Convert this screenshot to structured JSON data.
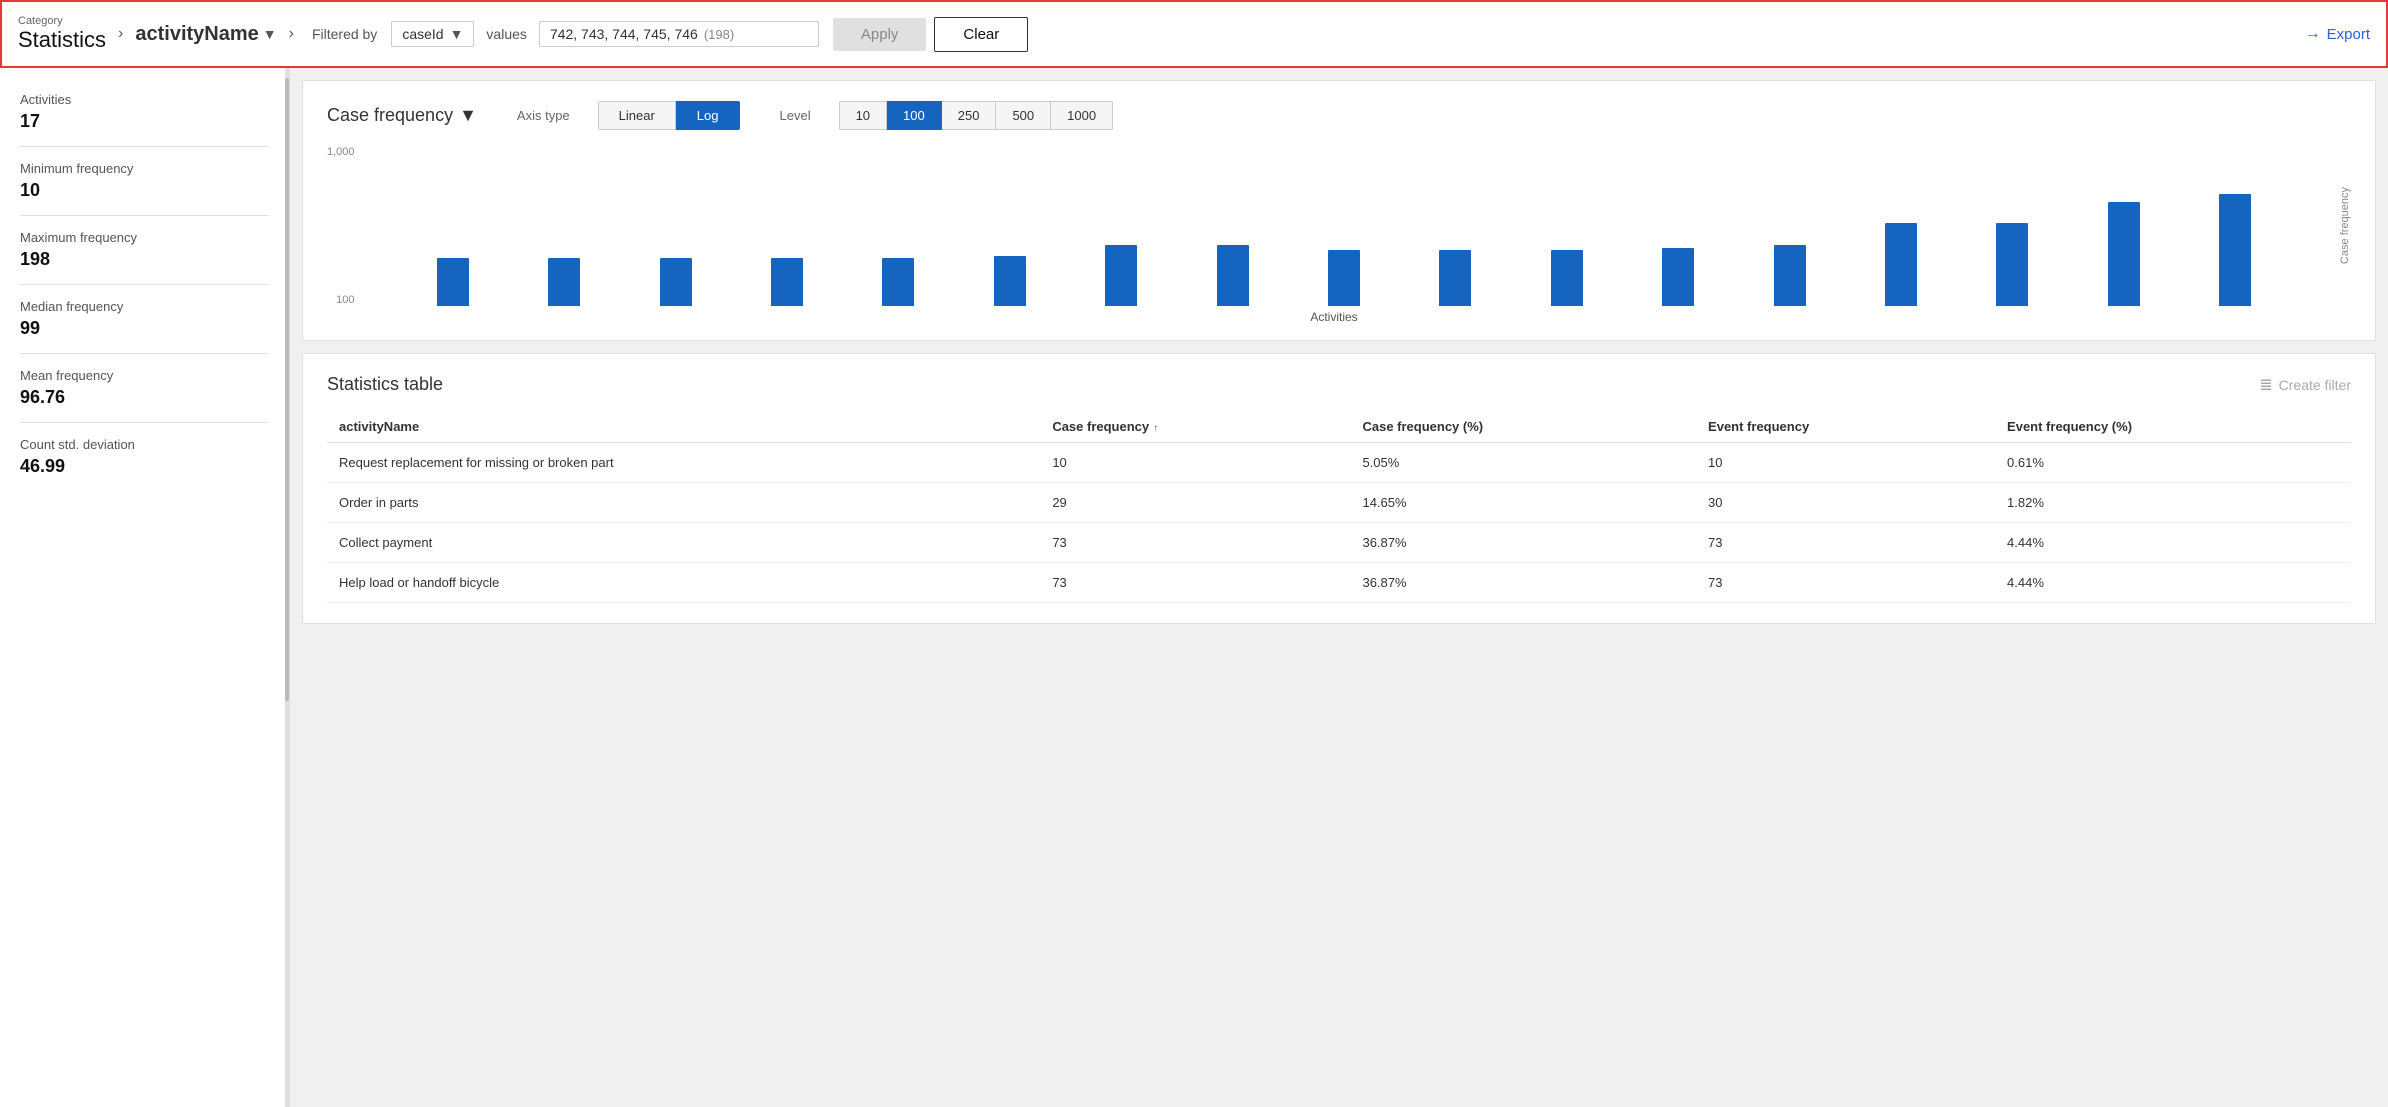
{
  "header": {
    "category_label": "Category",
    "category_value": "Statistics",
    "chevron": "›",
    "activity_name": "activityName",
    "chevron2": "›",
    "filtered_by": "Filtered by",
    "filter_field": "caseId",
    "values_label": "values",
    "values_text": "742, 743, 744, 745, 746",
    "values_count": "(198)",
    "apply_label": "Apply",
    "clear_label": "Clear",
    "export_label": "Export"
  },
  "sidebar": {
    "stats": [
      {
        "label": "Activities",
        "value": "17"
      },
      {
        "label": "Minimum frequency",
        "value": "10"
      },
      {
        "label": "Maximum frequency",
        "value": "198"
      },
      {
        "label": "Median frequency",
        "value": "99"
      },
      {
        "label": "Mean frequency",
        "value": "96.76"
      },
      {
        "label": "Count std. deviation",
        "value": "46.99"
      }
    ]
  },
  "chart": {
    "title": "Case frequency",
    "axis_type_label": "Axis type",
    "axis_options": [
      {
        "label": "Linear",
        "active": false
      },
      {
        "label": "Log",
        "active": true
      }
    ],
    "level_label": "Level",
    "level_options": [
      {
        "label": "10",
        "active": false
      },
      {
        "label": "100",
        "active": true
      },
      {
        "label": "250",
        "active": false
      },
      {
        "label": "500",
        "active": false
      },
      {
        "label": "1000",
        "active": false
      }
    ],
    "y_axis_labels": [
      "1,000",
      "100"
    ],
    "x_axis_label": "Activities",
    "y_axis_right_label": "Case frequency",
    "bars": [
      {
        "height_pct": 30
      },
      {
        "height_pct": 30
      },
      {
        "height_pct": 30
      },
      {
        "height_pct": 30
      },
      {
        "height_pct": 30
      },
      {
        "height_pct": 31
      },
      {
        "height_pct": 38
      },
      {
        "height_pct": 38
      },
      {
        "height_pct": 35
      },
      {
        "height_pct": 35
      },
      {
        "height_pct": 35
      },
      {
        "height_pct": 36
      },
      {
        "height_pct": 38
      },
      {
        "height_pct": 52
      },
      {
        "height_pct": 52
      },
      {
        "height_pct": 65
      },
      {
        "height_pct": 70
      }
    ]
  },
  "table": {
    "title": "Statistics table",
    "create_filter_label": "Create filter",
    "columns": [
      {
        "label": "activityName",
        "sortable": false
      },
      {
        "label": "Case frequency",
        "sortable": true
      },
      {
        "label": "Case frequency (%)",
        "sortable": false
      },
      {
        "label": "Event frequency",
        "sortable": false
      },
      {
        "label": "Event frequency (%)",
        "sortable": false
      }
    ],
    "rows": [
      {
        "activity": "Request replacement for missing or broken part",
        "case_freq": "10",
        "case_freq_pct": "5.05%",
        "event_freq": "10",
        "event_freq_pct": "0.61%"
      },
      {
        "activity": "Order in parts",
        "case_freq": "29",
        "case_freq_pct": "14.65%",
        "event_freq": "30",
        "event_freq_pct": "1.82%"
      },
      {
        "activity": "Collect payment",
        "case_freq": "73",
        "case_freq_pct": "36.87%",
        "event_freq": "73",
        "event_freq_pct": "4.44%"
      },
      {
        "activity": "Help load or handoff bicycle",
        "case_freq": "73",
        "case_freq_pct": "36.87%",
        "event_freq": "73",
        "event_freq_pct": "4.44%"
      }
    ]
  },
  "colors": {
    "active_btn": "#1565C0",
    "bar_color": "#1565C0",
    "border_highlight": "#e53935"
  }
}
